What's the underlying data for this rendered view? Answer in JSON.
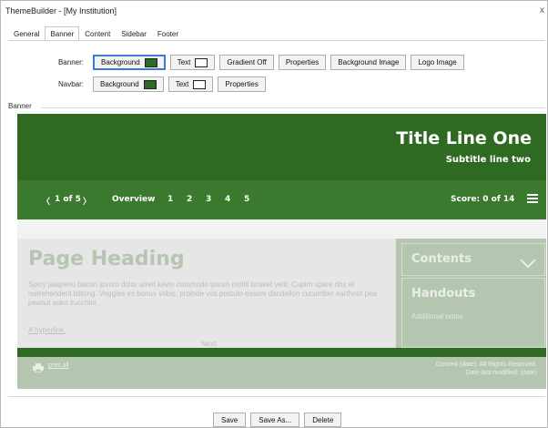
{
  "window": {
    "title": "ThemeBuilder - [My Institution]",
    "close_glyph": "x"
  },
  "tabs": [
    {
      "label": "General"
    },
    {
      "label": "Banner",
      "active": true
    },
    {
      "label": "Content"
    },
    {
      "label": "Sidebar"
    },
    {
      "label": "Footer"
    }
  ],
  "banner_row": {
    "label": "Banner:",
    "background": "Background",
    "text": "Text",
    "gradient": "Gradient Off",
    "properties": "Properties",
    "background_image": "Background Image",
    "logo_image": "Logo Image"
  },
  "navbar_row": {
    "label": "Navbar:",
    "background": "Background",
    "text": "Text",
    "properties": "Properties"
  },
  "group": {
    "label": "Banner"
  },
  "preview": {
    "title_line_one": "Title Line One",
    "subtitle": "Subtitle line two",
    "nav": {
      "prev_glyph": "〈",
      "position": "1 of 5",
      "next_glyph": "〉",
      "overview": "Overview",
      "pages": [
        "1",
        "2",
        "3",
        "4",
        "5"
      ],
      "score": "Score: 0 of 14",
      "menu_icon": "hamburger-menu-icon"
    },
    "page_heading": "Page Heading",
    "paragraph": "Spicy jalapeno bacon ipsum dolor amet kevin commodo ipsum mollit brisket velit. Cupim spare ribs et reprehenderit biltong. Veggies es bonus vobis, proinde vos postulo essum dandelion cucumber earthnut pea peanut soko zucchini.",
    "hyperlink": "A hyperlink.",
    "next_label": "Next",
    "sidebar": {
      "contents": "Contents",
      "handouts": "Handouts",
      "notes": "Additional notes"
    },
    "footer": {
      "print_label": "print all",
      "copyright": "Content (date). All Rights Reserved.",
      "modified": "Date last modified: (date)"
    }
  },
  "actions": {
    "save": "Save",
    "save_as": "Save As...",
    "delete": "Delete"
  },
  "colors": {
    "banner_green": "#2f6a22",
    "navbar_green": "#3b7a2e",
    "sidebar_green": "#b5c6b0",
    "swatch_text": "#ffffff"
  }
}
